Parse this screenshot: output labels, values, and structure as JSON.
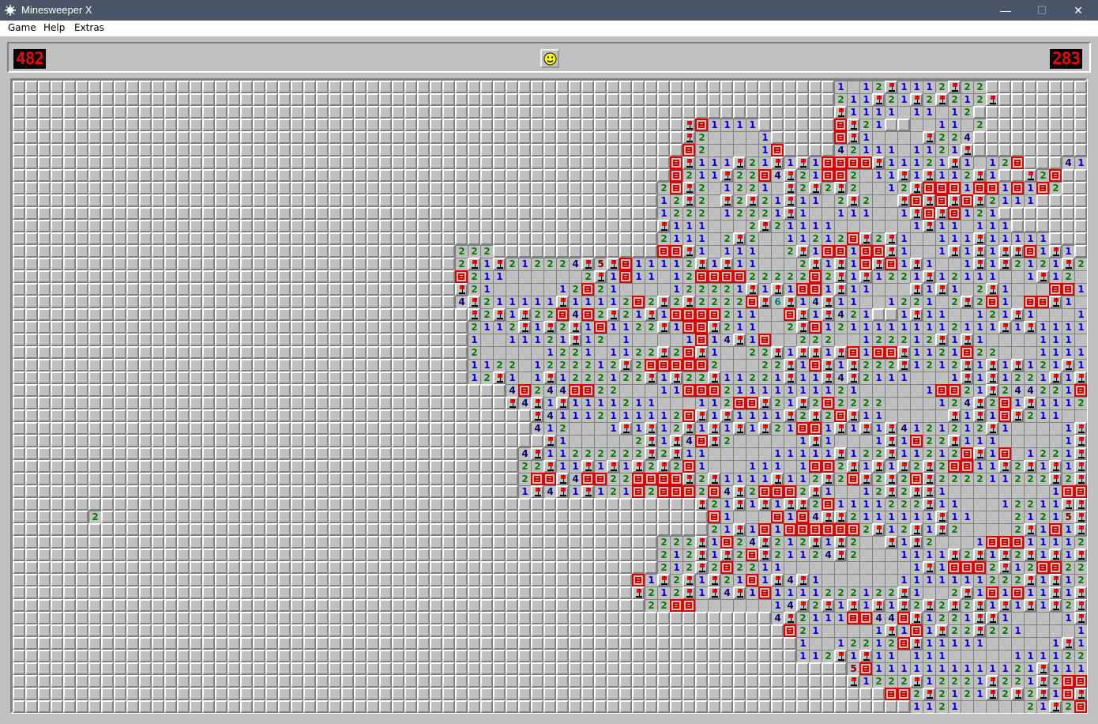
{
  "window": {
    "title": "Minesweeper X",
    "controls": {
      "minimize": "—",
      "maximize": "☐",
      "close": "✕"
    }
  },
  "menu": {
    "items": [
      "Game",
      "Help",
      "Extras"
    ]
  },
  "status": {
    "mine_counter": "482",
    "timer": "283",
    "face_icon": "smiley-face-icon"
  },
  "board": {
    "rows": [
      "hhhhhhhhhhhhhhhhhhhhhhhhhhhhhhhhhhhhhhhhhhhhhhhhhhhhhhhhhhhhhhhhh1o12f1112f22hhhhhhhhh",
      "hhhhhhhhhhhhhhhhhhhhhhhhhhhhhhhhhhhhhhhhhhhhhhhhhhhhhhhhhhhhhhhhh211f21f2f212fhhhhhhhh",
      "hhhhhhhhhhhhhhhhhhhhhhhhhhhhhhhhhhhhhhhhhhhhhhhhhhhhhhhhhhhhhhhhhf1111o11o12hhhhhhhhh",
      "hhhhhhhhhhhhhhhhhhhhhhhhhhhhhhhhhhhhhhhhhhhhhhhhhhhhhfm1111hhhhhhmf21hhoo11o2hhhhhhhh",
      "hhhhhhhhhhhhhhhhhhhhhhhhhhhhhhhhhhhhhhhhhhhhhhhhhhhhhf2oooo1hhhhhmf1oooof224hhhhhhhhh",
      "hhhhhhhhhhhhhhhhhhhhhhhhhhhhhhhhhhhhhhhhhhhhhhhhhhhhhm2oooo1mhhhh42111o1121fhhhhhhhhh",
      "hhhhhhhhhhhhhhhhhhhhhhhhhhhhhhhhhhhhhhhhhhhhhhhhhhhhmf111f21f1f1mmmmf11121f1o12mhhh41111",
      "hhhhhhhhhhhhhhhhhhhhhhhhhhhhhhhhhhhhhhhhhhhhhhhhhhhhm211f22m4f21mm2o11f1f112f1hhf2mhhhh",
      "hhhhhhhhhhhhhhhhhhhhhhhhhhhhhhhhhhhhhhhhhhhhhhhhhhh2mf2o1221of2f2f2oo12fmmm1mm1m1m2hhhh",
      "hhhhhhhhhhhhhhhhhhhhhhhhhhhhhhhhhhhhhhhhhhhhhhhhhhh12f2of2f21f11o2f2oofmfmfmf2111hhhhh",
      "hhhhhhhhhhhhhhhhhhhhhhhhhhhhhhhhhhhhhhhhhhhhhhhhhhh1222o12221f1oo111oo1fmfm121hhhhhhhh",
      "hhhhhhhhhhhhhhhhhhhhhhhhhhhhhhhhhhhhhhhhhhhhhhhhhhhf111ooo2f21111oooooo1f11o111hhhhhhhh",
      "hhhhhhhhhhhhhhhhhhhhhhhhhhhhhhhhhhhhhhhhhhhhhhhhhhh2111o2f2oo11212mf2f1oo111f11111hhhh",
      "hhhhhhhhhhhhhhhhhhhhhhhhhhhhhhhhhhh222hhhhhhhhhhhhhmmf1o111oo2f1mm1mmf1oo1f1f1ffm1f1hhhh",
      "hhhhhhhhhhhhhhhhhhhhhhhhhhhhhhhhhhh2f1f212224f5fm11112f1f11ooo2f1f1mfm1f1oo1f1f2121f21f1hh",
      "hhhhhhhhhhhhhhhhhhhhhhhhhhhhhhhhhhhm211oooooo2f1m11o12mmmm22222m2f1f1221f12111oo1f12o11111",
      "hhhhhhhhhhhhhhhhhhhhhhhhhhhhhhhhhhhf21ooooo12m21oooo122221f1f1mm1f11ooof1f1o2f1ooomm1f1ff1",
      "hhhhhhhhhhhhhhhhhhhhhhhhhhhhhhhhhhh4f211111f11112m2f2f2222mf6f14f11oo1221o2f2m1ommf1oo11",
      "hhhhhhhhhhhhhhhhhhhhhhhhhhhhhhhhhhhhf2f1f22m4m2f21f1mmmm211oomf1f421hh1f11oo121f1ooo121hh",
      "hhhhhhhhhhhhhhhhhhhhhhhhhhhhhhhhhhhh2112f1f2f1m1122f1mmf211oo2fm12111111112111f1f11112111oo111",
      "hhhhhhhhhhhhhhhhhhhhhhhhhhhhhhhhhhhh1oo11121f12o1oooo1m14f1moo222oo122212f1f1oooo111o12221",
      "hhhhhhhhhhhhhhhhhhhhhhhhhhhhhhhhhhhh2ooooo1221o1122f2mf1oo22f1ff1fm1mmf1121m22ooo111122f1f1",
      "hhhhhhhhhhhhhhhhhhhhhhhhhhhhhhhhhhhh1122o1222212f2mmmmm2ooo22f1mf1f222f1212f1f1f121f1f12f2f1",
      "hhhhhhhhhhhhhhhhhhhhhhhhhhhhhhhhhhhh12f1o1f1222122f1f22f11221f11f4f2111ooo1f1f1221f1f1f1f1f1",
      "hhhhhhhhhhhhhhhhhhhhhhhhhhhhhhhhhhhhhhh4m244mm22ooo11mmm21111111121ooooo1mm21f244221m2211hhh",
      "hhhhhhhhhhhhhhhhhhhhhhhhhhhhhhhhhhhhhhhf4f1f1111211ooo112mmf21f2m2222oooo124f2m1f1112f1hhhh",
      "hhhhhhhhhhhhhhhhhhhhhhhhhhhhhhhhhhhhhhhhhf41112111112mf1f1111f2f2mf11ooooof1f1mf211oo12m1hhh",
      "hhhhhhhhhhhhhhhhhhhhhhhhhhhhhhhhhhhhhhhhh412ooo1f1f12f1f1f1f21mm1f1f1f4121212f1oooo1f1ooo1f1hhh",
      "hhhhhhhhhhhhhhhhhhhhhhhhhhhhhhhhhhhhhhhhhhf1ooooo2f1f4mf2ooooo1f1ooo1f1m22f111ooooo1f1ooo22211",
      "hhhhhhhhhhhhhhhhhhhhhhhhhhhhhhhhhhhhhhhh4f11222222f2f11ooooo11111f122f11212mf1mo1221f1212",
      "hhhhhhhhhhhhhhhhhhhhhhhhhhhhhhhhhhhhhhhh22f11f1f1f2f2m1ooo111o1mm2f1f1f2f2mm11f2f1f1f2f22",
      "hhhhhhhhhhhhhhhhhhhhhhhhhhhhhhhhhhhhhhhh2mmf4mm22mmmmf2f1111f112f2mf2f2mf222211222f2f22f1",
      "hhhhhhhhhhhhhhhhhhhhhhhhhhhhhhhhhhhhhhhh1f4f1f121m2mmm2m4f2mmm2f1oo12f2ff1oooooooo1mmm1222f2f1",
      "hhhhhhhhhhhhhhhhhhhhhhhhhhhhhhhhhhhhhhhhhhhhhhhhhhhhhhf21f1f1ff2m1111222f11ooo12211ff1f1f1f1",
      "hhhhhhhhhhhhhhhhhhhhhhhhhhhhhhhhhhhhhhhhhhhhhhhhhhhhhhhm1ooom1m4ff2111111f11ooo21215f1f111f2mmm2",
      "hhhhhhhhhhhhhhhhhhhhhhhhhhhhhhhhhhhhhhhhhhhhhhhhhhhhhhh21f1m1mmmmmm2f12f1f2oooo2f1m1f1f1f1hh2f1",
      "hhhhhhhhhhhhhhhhhhhhhhhhhhhhhhhhhhhhhhhhhhhhhhhhhhh222f1m24f212f1f2oof1f2ooo1mmm1111222f15f41",
      "hhhhhhhhhhhhhhhhhhhhhhhhhhhhhhhhhhhhhhhhhhhhhhhhhhh212f1f2mf21124f2ooo1111f2f1f2f1f1f1f1f1",
      "hhhhhhhhhhhhhhhhhhhhhhhhhhhhhhhhhhhhhhhhhhhhhhhhhhh212f2m2211oooooooooo1f1mmm2f12mm224f2",
      "hhhhhhhhhhhhhhhhhhhhhhhhhhhhhhhhhhhhhhhhhhhhhhhhhm1f2f1f21m1f4f1oooooo1111111222f1f1212f1",
      "hhhhhhhhhhhhhhhhhhhhhhhhhhhhhhhhhhhhhhhhhhhhhhhhhf212f1f4f1m1111222122f1oo2f1m1m11f1f2f1f1",
      "hhhhhhhhhhhhhhhhhhhhhhhhhhhhhhhhhhhhhhhhhhhhhhhhhh22mmoooooo14f2f1f1f1f2f2f2f1f1f1f2f2211",
      "hhhhhhhhhhhhhhhhhhhhhhhhhhhhhhhhhhhhhhhhhhhhhhhhhhhhhhhhhhhh4f2111mm44mf1221ff1oooo1ff1f1f1",
      "hhhhhhhhhhhhhhhhhhhhhhhhhhhhhhhhhhhhhhhhhhhhhhhhhhhhhhhhhhhhhm21oooo1f1m1f22f221oooo1mmf1f1f",
      "hhhhhhhhhhhhhhhhhhhhhhhhhhhhhhhhhhhhhhhhhhhhhhhhhhhhhhhhhhhhhh1oo12212mf11111ooooo1f1f4f2111",
      "hhhhhhhhhhhhhhhhhhhhhhhhhhhhhhhhhhhhhhhhhhhhhhhhhhhhhhhhhhhhhh112f1f11o111ooooo1111221m1f221",
      "hhhhhhhhhhhhhhhhhhhhhhhhhhhhhhhhhhhhhhhhhhhhhhhhhhhhhhhhhhhhhhhhhh5m1111111111121f111122",
      "hhhhhhhhhhhhhhhhhhhhhhhhhhhhhhhhhhhhhhhhhhhhhhhhhhhhhhhhhhhhhhhhhhf1222f12221f221f2mmmm2fm1f22",
      "hhhhhhhhhhhhhhhhhhhhhhhhhhhhhhhhhhhhhhhhhhhhhhhhhhhhhhhhhhhhhhhhhhhhhmm2f2121f2f2f1mf1f2f2f1f2f42",
      "hhhhhhhhhhhhhhhhhhhhhhhhhhhhhhhhhhhhhhhhhhhhhhhhhhhhhhhhhhhhhhhhhhhhhhh1121ooooo21f2m2f2f2f1mf12"
    ],
    "isolated_revealed": {
      "row": 34,
      "col": 6,
      "value": "2"
    }
  },
  "colors": {
    "title_bar": "#4a5568",
    "face": "#c0c0c0",
    "lcd_background": "#000000",
    "lcd_digits": "#ff0000",
    "mine_red": "#e00000",
    "n1": "#0000ff",
    "n2": "#008000",
    "n3": "#ff0000",
    "n4": "#000080",
    "n5": "#800000",
    "n6": "#008080"
  }
}
